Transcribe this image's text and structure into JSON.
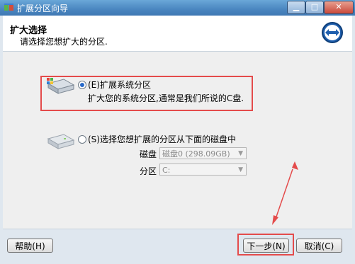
{
  "window": {
    "title": "扩展分区向导",
    "controls": {
      "minimize": "▁",
      "maximize": "□",
      "close": "✕"
    }
  },
  "header": {
    "title": "扩大选择",
    "subtitle": "请选择您想扩大的分区.",
    "icon": "two-way-arrow-icon"
  },
  "options": {
    "system": {
      "label": "(E)扩展系统分区",
      "description": "扩大您的系统分区,通常是我们所说的C盘.",
      "selected": true
    },
    "other": {
      "label": "(S)选择您想扩展的分区从下面的磁盘中",
      "selected": false
    }
  },
  "fields": {
    "disk": {
      "label": "磁盘",
      "value": "磁盘0 (298.09GB)"
    },
    "partition": {
      "label": "分区",
      "value": "C:"
    }
  },
  "footer": {
    "help": "帮助(H)",
    "next": "下一步(N)",
    "cancel": "取消(C)"
  },
  "colors": {
    "highlight_red": "#e44b4b",
    "titlebar_blue": "#4a86c0"
  }
}
